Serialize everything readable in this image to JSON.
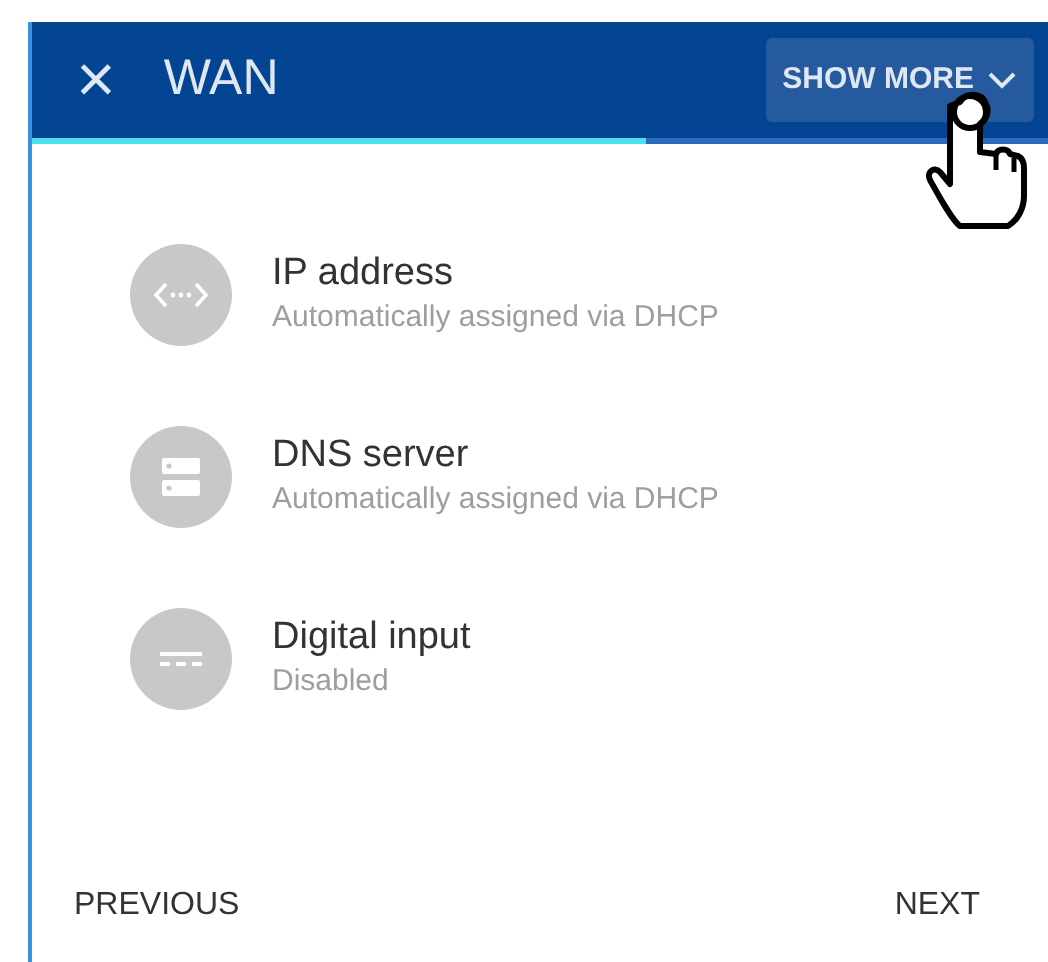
{
  "header": {
    "close": "×",
    "title": "WAN",
    "show_more": "SHOW MORE"
  },
  "progress": {
    "level": 0.6
  },
  "items": [
    {
      "kind": "ip",
      "title": "IP address",
      "subtitle": "Automatically assigned via DHCP"
    },
    {
      "kind": "dns",
      "title": "DNS server",
      "subtitle": "Automatically assigned via DHCP"
    },
    {
      "kind": "digital",
      "title": "Digital input",
      "subtitle": "Disabled"
    }
  ],
  "footer": {
    "previous": "PREVIOUS",
    "next": "NEXT"
  }
}
